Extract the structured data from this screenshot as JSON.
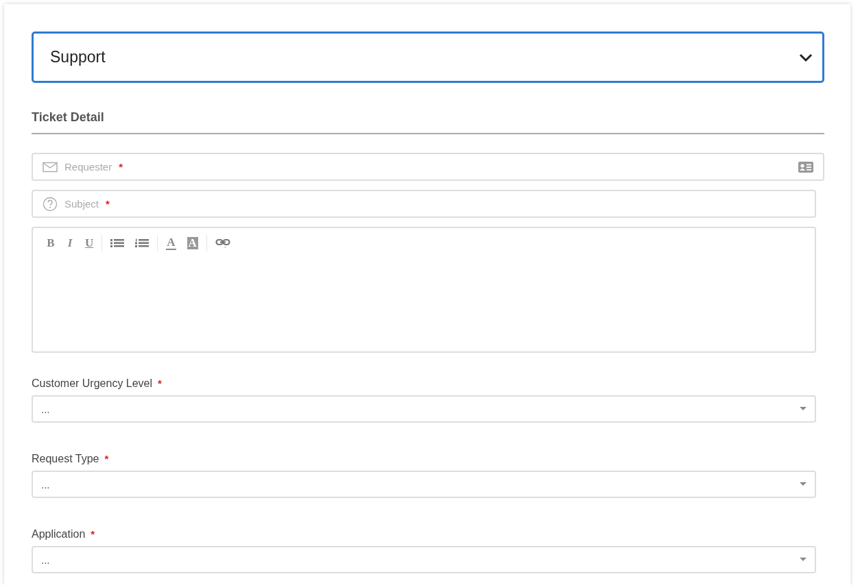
{
  "form_selector": {
    "value": "Support"
  },
  "section_title": "Ticket Detail",
  "inputs": [
    {
      "kind": "email",
      "placeholder": "Requester",
      "required_mark": "*"
    },
    {
      "kind": "question",
      "placeholder": "Subject",
      "required_mark": "*"
    }
  ],
  "editor": {
    "toolbar_groups": [
      [
        {
          "kind": "bold",
          "label": "B"
        },
        {
          "kind": "italic",
          "label": "I"
        },
        {
          "kind": "underline",
          "label": "U"
        }
      ],
      [
        {
          "kind": "bullet-list"
        },
        {
          "kind": "numbered-list"
        }
      ],
      [
        {
          "kind": "text-color",
          "label": "A"
        },
        {
          "kind": "background-color",
          "label": "A"
        }
      ],
      [
        {
          "kind": "link"
        }
      ]
    ]
  },
  "dropdowns": [
    {
      "label": "Customer Urgency Level",
      "required_mark": "*",
      "value": "..."
    },
    {
      "label": "Request Type",
      "required_mark": "*",
      "value": "..."
    },
    {
      "label": "Application",
      "required_mark": "*",
      "value": "..."
    }
  ]
}
